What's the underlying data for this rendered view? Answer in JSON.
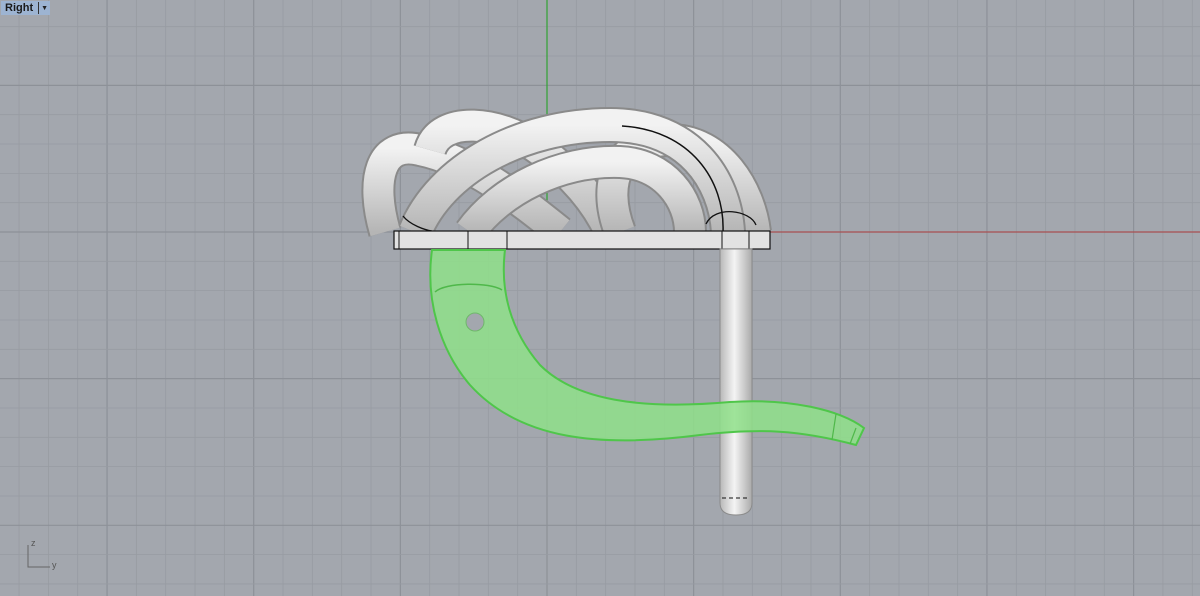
{
  "viewport": {
    "name": "Right",
    "menu_icon": "dropdown-triangle-icon",
    "axis_labels": {
      "vertical": "z",
      "horizontal": "y"
    }
  },
  "colors": {
    "background": "#a3a7ae",
    "grid_minor": "#979ba2",
    "grid_major": "#8d9198",
    "x_axis": "#b04040",
    "z_axis": "#1fa51f",
    "selection": "#8fe08a",
    "model": "#d8d8d8"
  }
}
